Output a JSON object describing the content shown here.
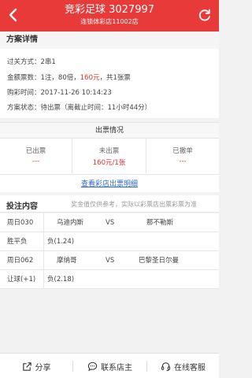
{
  "header": {
    "title": "竞彩足球 3027997",
    "subtitle": "连锁体彩店11002店",
    "back_icon": "back-arrow-icon",
    "refresh_icon": "refresh-icon"
  },
  "details": {
    "section_title": "方案详情",
    "pass_label": "过关方式：",
    "pass_value": "2串1",
    "amount_label": "金额票数：",
    "amount_pre": "1注，80倍，",
    "amount_price": "160元",
    "amount_post": "，共1张票",
    "buy_time_label": "购彩时间：",
    "buy_time_value": "2017-11-26 10:14:23",
    "status_label": "方案状态：",
    "status_value": "待出票（离截止时间：11小时44分）"
  },
  "ticket": {
    "title": "出票情况",
    "columns": [
      {
        "label": "已出票",
        "value": "---"
      },
      {
        "label": "未出票",
        "value": "160元/1张"
      },
      {
        "label": "已撤单",
        "value": "---"
      }
    ],
    "link": "查看彩店出票明细"
  },
  "bets": {
    "title": "投注内容",
    "note": "奖金值仅供参考，实际以彩票店出票彩票为准",
    "rows": [
      {
        "type": "match",
        "id": "周日030",
        "home": "乌迪内斯",
        "vs": "VS",
        "away": "那不勒斯"
      },
      {
        "type": "odd",
        "label": "胜平负",
        "value": "负(1.24)"
      },
      {
        "type": "match",
        "id": "周日062",
        "home": "摩纳哥",
        "vs": "VS",
        "away": "巴黎圣日尔曼"
      },
      {
        "type": "odd",
        "label": "让球(+1)",
        "value": "负(2.18)"
      }
    ]
  },
  "footer": {
    "share": "分享",
    "contact": "联系店主",
    "service": "在线客服"
  },
  "colors": {
    "accent": "#e93a3a",
    "link": "#2f66c9",
    "price": "#e03030"
  }
}
